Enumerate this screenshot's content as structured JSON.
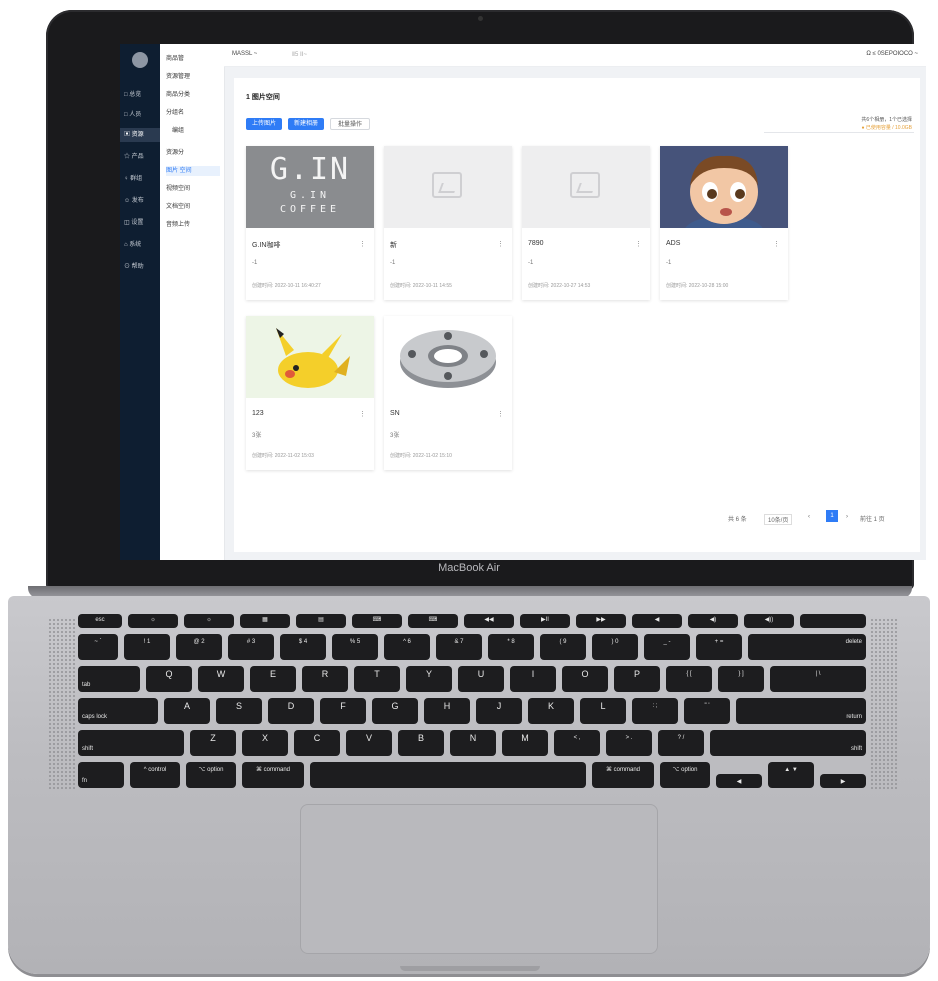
{
  "laptop": {
    "model_label": "MacBook Air"
  },
  "app": {
    "topbar": {
      "breadcrumb_left": "MASSL ~",
      "breadcrumb_right": "Ⅱ5 ⅠⅠ~",
      "user": "Ω ≤ 0SEPOIOCO ~"
    },
    "nav": {
      "items": [
        "□ 总览",
        "□ 人员",
        "▣ 资源",
        "☆ 产品",
        "♀ 群组",
        "☺ 发布",
        "◫ 设置",
        "⌂ 系统",
        "⊙ 帮助"
      ],
      "active_index": 2
    },
    "sidebar": {
      "items": [
        "商品管",
        "资源管理",
        "商品分类",
        "分组名",
        "编组",
        "资源分",
        "图片 空间",
        "视频空间",
        "文档空间",
        "音频上传"
      ],
      "active_index": 6
    },
    "header": {
      "title": "1 图片空间",
      "buttons": [
        "上传图片",
        "新建相册",
        "批量操作"
      ],
      "stats_line1": "共6个相册，1个已选择",
      "stats_line2": "● 已使用容量 / 10.0GB"
    },
    "cards": [
      {
        "title": "G.IN咖啡",
        "sub": "-1",
        "date": "创建时间: 2022-10-11 16:40:27",
        "thumb": "gin-coffee-logo"
      },
      {
        "title": "新",
        "sub": "-1",
        "date": "创建时间: 2022-10-11 14:55",
        "thumb": "placeholder"
      },
      {
        "title": "7890",
        "sub": "-1",
        "date": "创建时间: 2022-10-27 14:53",
        "thumb": "placeholder"
      },
      {
        "title": "ADS",
        "sub": "-1",
        "date": "创建时间: 2022-10-28 15:00",
        "thumb": "cartoon-boy"
      },
      {
        "title": "123",
        "sub": "3张",
        "date": "创建时间: 2022-11-02 15:03",
        "thumb": "pikachu"
      },
      {
        "title": "SN",
        "sub": "3张",
        "date": "创建时间: 2022-11-02 15:10",
        "thumb": "steel-flange"
      }
    ],
    "logo_text": {
      "mark": "G.IN",
      "line1": "G.IN",
      "line2": "COFFEE"
    },
    "pagination": {
      "total": "共 6 条",
      "page_size": "10条/页",
      "current": "1",
      "goto": "前往 1 页"
    }
  },
  "keyboard": {
    "row1": [
      "esc",
      "☼",
      "☼",
      "▦",
      "▤",
      "⌨",
      "⌨",
      "◀◀",
      "▶II",
      "▶▶",
      "◀",
      "◀)",
      "◀))"
    ],
    "row2": [
      "~ `",
      "! 1",
      "@ 2",
      "# 3",
      "$ 4",
      "% 5",
      "^ 6",
      "& 7",
      "* 8",
      "( 9",
      ") 0",
      "_ -",
      "+ =",
      "delete"
    ],
    "row3": [
      "tab",
      "Q",
      "W",
      "E",
      "R",
      "T",
      "Y",
      "U",
      "I",
      "O",
      "P",
      "{ [",
      "} ]",
      "| \\"
    ],
    "row4": [
      "caps lock",
      "A",
      "S",
      "D",
      "F",
      "G",
      "H",
      "J",
      "K",
      "L",
      ": ;",
      "\" '",
      "return"
    ],
    "row5": [
      "shift",
      "Z",
      "X",
      "C",
      "V",
      "B",
      "N",
      "M",
      "< ,",
      "> .",
      "? /",
      "shift"
    ],
    "row6": [
      "fn",
      "^ control",
      "⌥ option",
      "⌘ command",
      "",
      "⌘ command",
      "⌥ option",
      "◀",
      "▲ ▼",
      "▶"
    ]
  },
  "colors": {
    "primary": "#2f7cf6",
    "nav_bg": "#0e1e31",
    "logo_bg": "#8a8c8f"
  }
}
